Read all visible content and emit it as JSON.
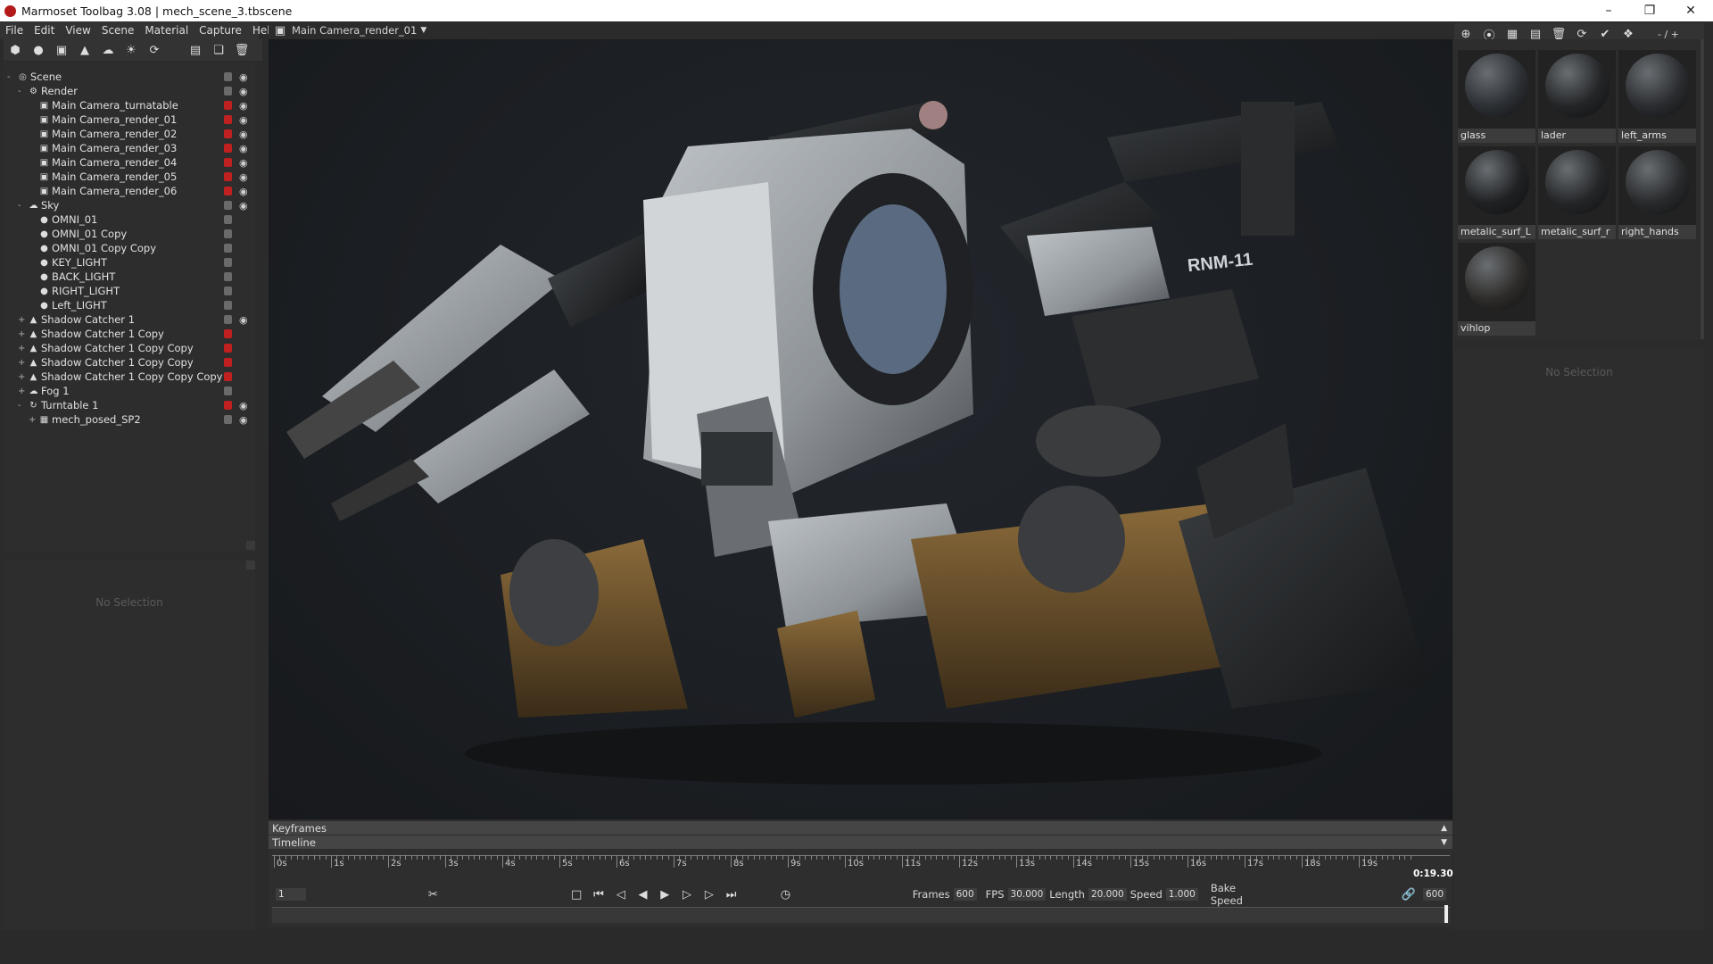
{
  "window": {
    "title": "Marmoset Toolbag 3.08  |  mech_scene_3.tbscene"
  },
  "menu": [
    "File",
    "Edit",
    "View",
    "Scene",
    "Material",
    "Capture",
    "Help"
  ],
  "viewport": {
    "camera_label": "Main Camera_render_01",
    "mech_decal": "RNM-11"
  },
  "scene_tree": [
    {
      "label": "Scene",
      "level": 0,
      "icon": "scene-icon",
      "expand": "-"
    },
    {
      "label": "Render",
      "level": 1,
      "icon": "gear-icon",
      "expand": "-"
    },
    {
      "label": "Main Camera_turnatable",
      "level": 2,
      "icon": "camera-icon",
      "lock": "red"
    },
    {
      "label": "Main Camera_render_01",
      "level": 2,
      "icon": "camera-icon",
      "lock": "red"
    },
    {
      "label": "Main Camera_render_02",
      "level": 2,
      "icon": "camera-icon",
      "lock": "red"
    },
    {
      "label": "Main Camera_render_03",
      "level": 2,
      "icon": "camera-icon",
      "lock": "red"
    },
    {
      "label": "Main Camera_render_04",
      "level": 2,
      "icon": "camera-icon",
      "lock": "red"
    },
    {
      "label": "Main Camera_render_05",
      "level": 2,
      "icon": "camera-icon",
      "lock": "red"
    },
    {
      "label": "Main Camera_render_06",
      "level": 2,
      "icon": "camera-icon",
      "lock": "red"
    },
    {
      "label": "Sky",
      "level": 1,
      "icon": "sky-icon",
      "expand": "-"
    },
    {
      "label": "OMNI_01",
      "level": 2,
      "icon": "light-icon"
    },
    {
      "label": "OMNI_01 Copy",
      "level": 2,
      "icon": "light-icon"
    },
    {
      "label": "OMNI_01 Copy Copy",
      "level": 2,
      "icon": "light-icon"
    },
    {
      "label": "KEY_LIGHT",
      "level": 2,
      "icon": "light-icon"
    },
    {
      "label": "BACK_LIGHT",
      "level": 2,
      "icon": "light-icon"
    },
    {
      "label": "RIGHT_LIGHT",
      "level": 2,
      "icon": "light-icon"
    },
    {
      "label": "Left_LIGHT",
      "level": 2,
      "icon": "light-icon"
    },
    {
      "label": "Shadow Catcher 1",
      "level": 1,
      "icon": "shadow-catcher-icon",
      "expand": "+"
    },
    {
      "label": "Shadow Catcher 1 Copy",
      "level": 1,
      "icon": "shadow-catcher-icon",
      "expand": "+",
      "lock": "red"
    },
    {
      "label": "Shadow Catcher 1 Copy Copy",
      "level": 1,
      "icon": "shadow-catcher-icon",
      "expand": "+",
      "lock": "red"
    },
    {
      "label": "Shadow Catcher 1 Copy Copy",
      "level": 1,
      "icon": "shadow-catcher-icon",
      "expand": "+",
      "lock": "red"
    },
    {
      "label": "Shadow Catcher 1 Copy Copy Copy",
      "level": 1,
      "icon": "shadow-catcher-icon",
      "expand": "+",
      "lock": "red"
    },
    {
      "label": "Fog 1",
      "level": 1,
      "icon": "fog-icon",
      "expand": "+"
    },
    {
      "label": "Turntable 1",
      "level": 1,
      "icon": "turntable-icon",
      "expand": "-",
      "lock": "red"
    },
    {
      "label": "mech_posed_SP2",
      "level": 2,
      "icon": "mesh-icon",
      "expand": "+"
    }
  ],
  "scene_props": {
    "no_selection": "No Selection"
  },
  "materials": [
    {
      "name": "glass"
    },
    {
      "name": "lader"
    },
    {
      "name": "left_arms"
    },
    {
      "name": "metalic_surf_L"
    },
    {
      "name": "metalic_surf_r"
    },
    {
      "name": "right_hands"
    },
    {
      "name": "vihlop"
    }
  ],
  "material_props": {
    "no_selection": "No Selection"
  },
  "material_toolbar": {
    "page": "- / +"
  },
  "timeline": {
    "keyframes_label": "Keyframes",
    "timeline_label": "Timeline",
    "ticks": [
      "0s",
      "1s",
      "2s",
      "3s",
      "4s",
      "5s",
      "6s",
      "7s",
      "8s",
      "9s",
      "10s",
      "11s",
      "12s",
      "13s",
      "14s",
      "15s",
      "16s",
      "17s",
      "18s",
      "19s"
    ],
    "current_time": "0:19.30",
    "frame_field": "1",
    "frames_label": "Frames",
    "frames": "600",
    "fps_label": "FPS",
    "fps": "30.000",
    "length_label": "Length",
    "length": "20.000",
    "speed_label": "Speed",
    "speed": "1.000",
    "bake_speed": "Bake Speed",
    "end_frame": "600"
  }
}
